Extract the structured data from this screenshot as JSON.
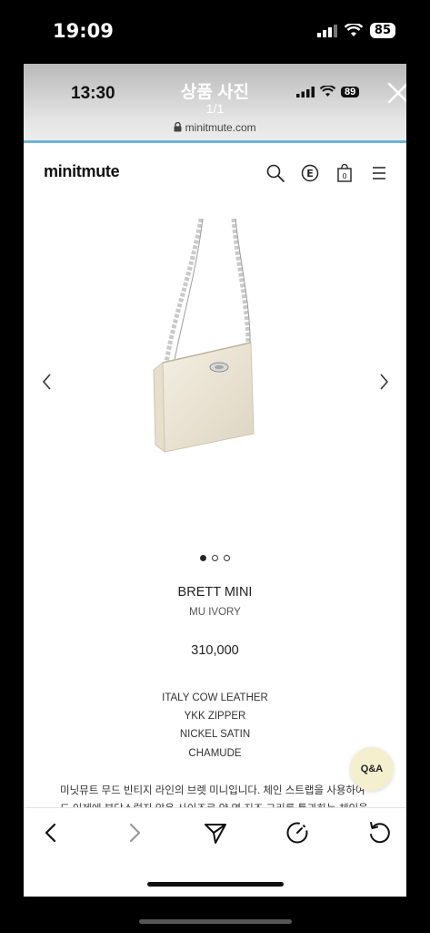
{
  "outer_status": {
    "time": "19:09",
    "battery": "85"
  },
  "viewer": {
    "time": "13:30",
    "title": "상품 사진",
    "count": "1/1",
    "url": "minitmute.com",
    "battery": "89"
  },
  "site": {
    "logo": "minitmute",
    "cart_count": "0",
    "icons": [
      "search-icon",
      "e-circle-icon",
      "cart-icon",
      "menu-icon"
    ]
  },
  "product": {
    "name": "BRETT MINI",
    "color": "MU IVORY",
    "price": "310,000",
    "specs": [
      "ITALY COW LEATHER",
      "YKK ZIPPER",
      "NICKEL SATIN",
      "CHAMUDE"
    ],
    "description": "미닛뮤트 무드 빈티지 라인의 브렛 미니입니다. 체인 스트랩을 사용하여",
    "description_line2": "드 이제에 부담스럽지 않은 사이즈로 양 옆 지즈 그리를 통과하는 체인을",
    "carousel": {
      "total": 3,
      "active": 0
    }
  },
  "qa_button": "Q&A",
  "toolbar": {
    "icons": [
      "back-icon",
      "forward-icon",
      "share-icon",
      "history-icon",
      "refresh-icon"
    ]
  },
  "colors": {
    "accent_line": "#6fb3d9",
    "qa_bg": "#f4efcf",
    "bag": "#ece6d6"
  }
}
